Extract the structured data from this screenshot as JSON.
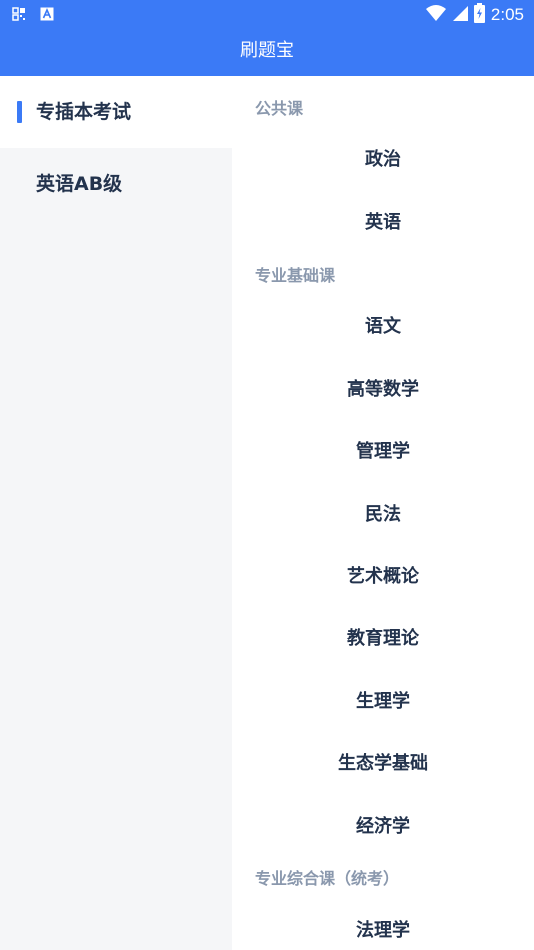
{
  "status_bar": {
    "time": "2:05",
    "icons": [
      "qr-grid-icon",
      "a-letter-icon",
      "wifi-icon",
      "cell-signal-icon",
      "battery-charging-icon"
    ],
    "color": "#3b7af6"
  },
  "app_bar": {
    "title": "刷题宝",
    "color": "#3b7af6"
  },
  "sidebar": {
    "items": [
      {
        "label": "专插本考试",
        "active": true
      },
      {
        "label": "英语AB级",
        "active": false
      }
    ]
  },
  "content": {
    "sections": [
      {
        "header": "公共课",
        "subjects": [
          "政治",
          "英语"
        ]
      },
      {
        "header": "专业基础课",
        "subjects": [
          "语文",
          "高等数学",
          "管理学",
          "民法",
          "艺术概论",
          "教育理论",
          "生理学",
          "生态学基础",
          "经济学"
        ]
      },
      {
        "header": "专业综合课（统考）",
        "subjects": [
          "法理学"
        ]
      }
    ]
  }
}
